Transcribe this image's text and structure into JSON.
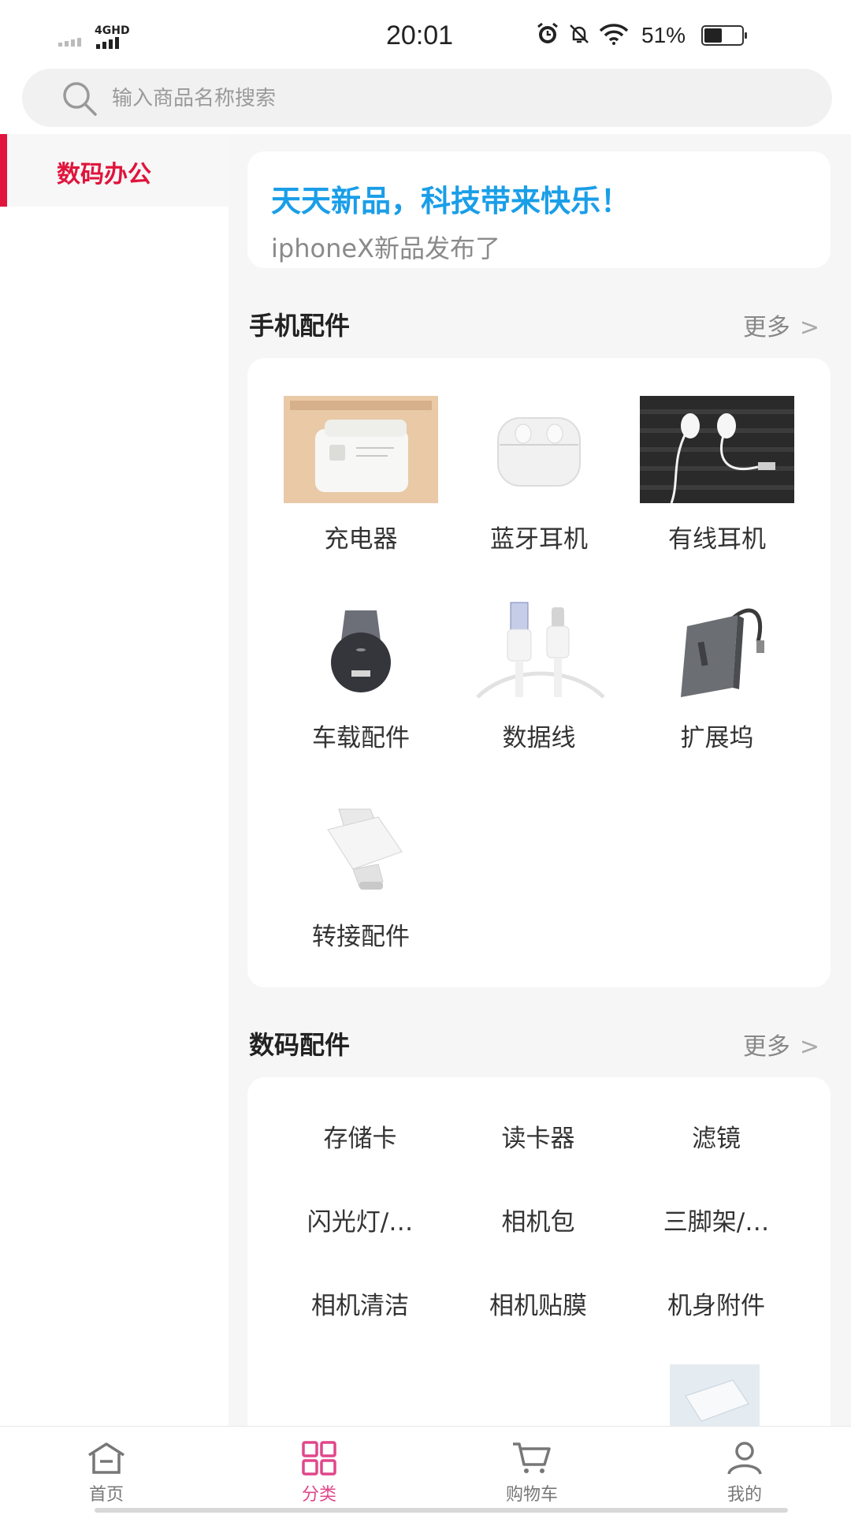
{
  "status_bar": {
    "network": "4GHD",
    "time": "20:01",
    "battery_percent": "51%",
    "battery_level": 0.51,
    "icons": [
      "alarm-icon",
      "mute-bell-icon",
      "wifi-icon",
      "battery-icon"
    ]
  },
  "search": {
    "placeholder": "输入商品名称搜索"
  },
  "sidebar": {
    "items": [
      {
        "label": "数码办公",
        "active": true
      }
    ]
  },
  "banner": {
    "title": "天天新品，科技带来快乐！",
    "subtitle": "iphoneX新品发布了"
  },
  "section_phone": {
    "title": "手机配件",
    "more": "更多",
    "items": [
      {
        "label": "充电器",
        "image": "charger"
      },
      {
        "label": "蓝牙耳机",
        "image": "bluetooth-earbuds"
      },
      {
        "label": "有线耳机",
        "image": "wired-earphones"
      },
      {
        "label": "车载配件",
        "image": "car-charger"
      },
      {
        "label": "数据线",
        "image": "usb-cable"
      },
      {
        "label": "扩展坞",
        "image": "usb-hub"
      },
      {
        "label": "转接配件",
        "image": "otg-adapter"
      }
    ]
  },
  "section_digital": {
    "title": "数码配件",
    "more": "更多",
    "items": [
      {
        "label": "存储卡"
      },
      {
        "label": "读卡器"
      },
      {
        "label": "滤镜"
      },
      {
        "label": "闪光灯/…"
      },
      {
        "label": "相机包"
      },
      {
        "label": "三脚架/…"
      },
      {
        "label": "相机清洁"
      },
      {
        "label": "相机贴膜"
      },
      {
        "label": "机身附件"
      }
    ]
  },
  "bottom_nav": {
    "items": [
      {
        "label": "首页",
        "icon": "home-icon",
        "active": false
      },
      {
        "label": "分类",
        "icon": "category-grid-icon",
        "active": true
      },
      {
        "label": "购物车",
        "icon": "cart-icon",
        "active": false
      },
      {
        "label": "我的",
        "icon": "user-icon",
        "active": false
      }
    ]
  },
  "colors": {
    "accent_red": "#e0143c",
    "banner_blue": "#1a9ee8",
    "nav_active": "#e0478a"
  }
}
